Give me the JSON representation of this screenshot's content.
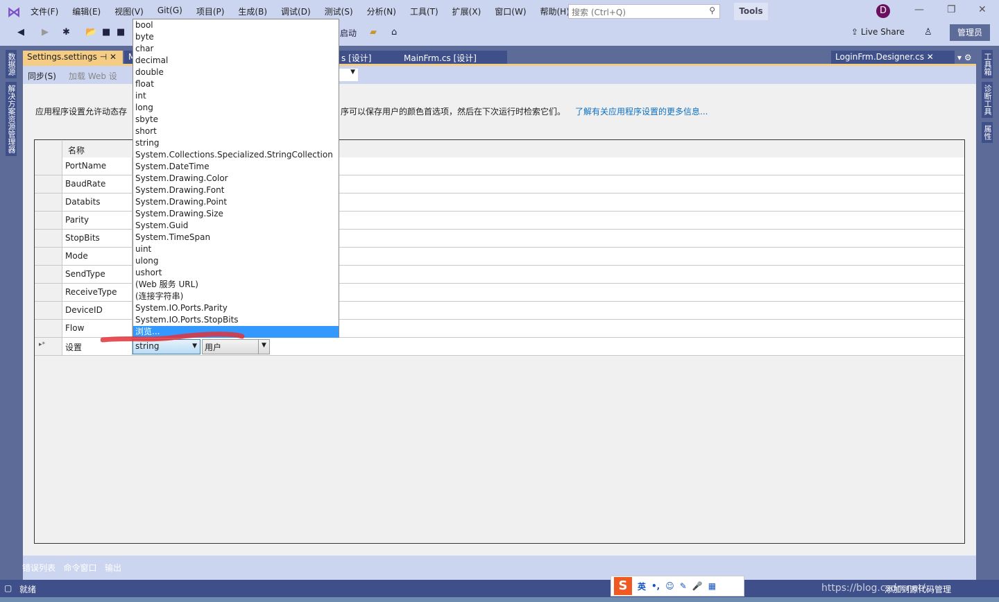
{
  "menubar": {
    "items": [
      "文件(F)",
      "编辑(E)",
      "视图(V)",
      "Git(G)",
      "项目(P)",
      "生成(B)",
      "调试(D)",
      "测试(S)",
      "分析(N)",
      "工具(T)",
      "扩展(X)",
      "窗口(W)",
      "帮助(H)"
    ],
    "search_placeholder": "搜索 (Ctrl+Q)",
    "tools_label": "Tools",
    "avatar_letter": "D"
  },
  "toolbar": {
    "start_label": "启动",
    "live_share": "Live Share",
    "admin": "管理员"
  },
  "left_panels": [
    "数据源",
    "解决方案资源管理器"
  ],
  "right_panels": [
    "工具箱",
    "诊断工具",
    "属性"
  ],
  "tabs": [
    {
      "label": "Settings.settings",
      "active": true
    },
    {
      "label": "M"
    },
    {
      "label": "s [设计]"
    },
    {
      "label": "MainFrm.cs [设计]"
    },
    {
      "label": "LoginFrm.Designer.cs"
    }
  ],
  "subtoolbar": {
    "sync": "同步(S)",
    "load_web": "加载 Web 设"
  },
  "description": "应用程序设置允许动态存",
  "description_tail": "序可以保存用户的颜色首选项，然后在下次运行时检索它们。",
  "learn_more": "了解有关应用程序设置的更多信息...",
  "grid": {
    "header": "名称",
    "rows": [
      "PortName",
      "BaudRate",
      "Databits",
      "Parity",
      "StopBits",
      "Mode",
      "SendType",
      "ReceiveType",
      "DeviceID",
      "Flow"
    ],
    "new_row": {
      "name": "设置",
      "type": "string",
      "scope": "用户"
    }
  },
  "dropdown": {
    "items": [
      "bool",
      "byte",
      "char",
      "decimal",
      "double",
      "float",
      "int",
      "long",
      "sbyte",
      "short",
      "string",
      "System.Collections.Specialized.StringCollection",
      "System.DateTime",
      "System.Drawing.Color",
      "System.Drawing.Font",
      "System.Drawing.Point",
      "System.Drawing.Size",
      "System.Guid",
      "System.TimeSpan",
      "uint",
      "ulong",
      "ushort",
      "(Web 服务 URL)",
      "(连接字符串)",
      "System.IO.Ports.Parity",
      "System.IO.Ports.StopBits",
      "浏览..."
    ],
    "selected": "浏览..."
  },
  "bottom_tabs": [
    "错误列表",
    "命令窗口",
    "输出"
  ],
  "status": {
    "text": "就绪",
    "watermark": "https://blog.csdn.net/...",
    "add_source": "添加到源代码管理"
  },
  "ime": {
    "lang": "英"
  }
}
